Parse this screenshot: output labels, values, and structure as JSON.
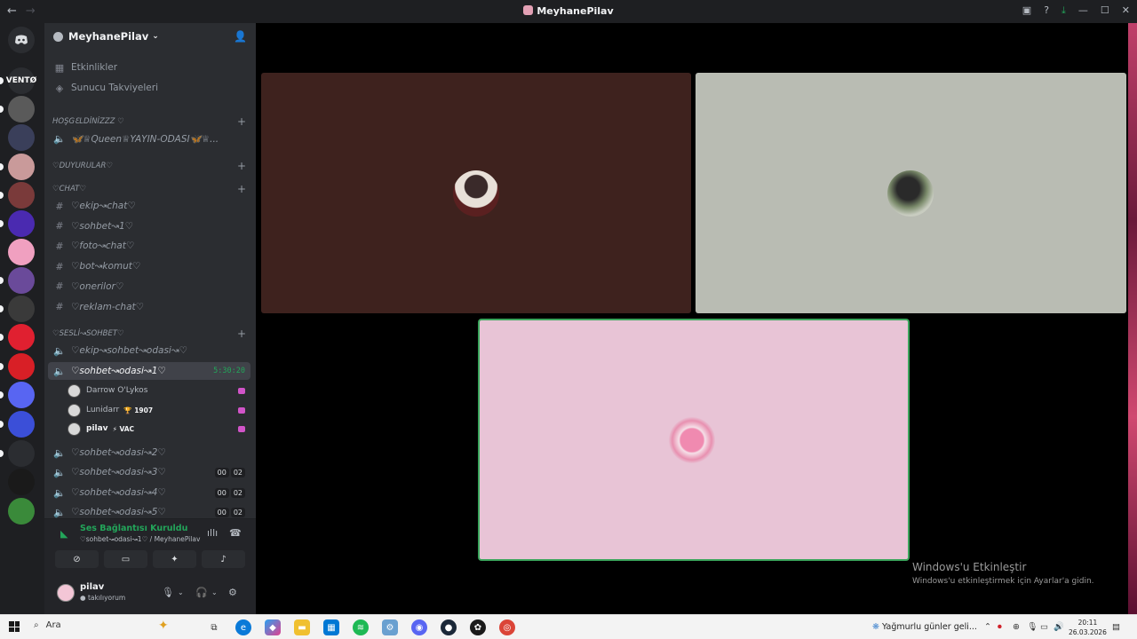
{
  "window": {
    "title": "MeyhanePilav",
    "nav_back": "←",
    "nav_forward": "→"
  },
  "server_rail": {
    "items": [
      {
        "label": "VENTØ",
        "color": "#2b2d31"
      },
      {
        "label": "",
        "color": "#5a5a5a"
      },
      {
        "label": "",
        "color": "#3a3f5a"
      },
      {
        "label": "",
        "color": "#c99a9a"
      },
      {
        "label": "",
        "color": "#7a3a3a"
      },
      {
        "label": "",
        "color": "#4a2ab0"
      },
      {
        "label": "",
        "color": "#f0a0c0"
      },
      {
        "label": "",
        "color": "#6a4a9a"
      },
      {
        "label": "",
        "color": "#3a3a3a"
      },
      {
        "label": "",
        "color": "#e02030"
      },
      {
        "label": "",
        "color": "#d81f26"
      },
      {
        "label": "",
        "color": "#5865f2"
      },
      {
        "label": "",
        "color": "#3b4fd8"
      },
      {
        "label": "",
        "color": "#2b2d31"
      },
      {
        "label": "",
        "color": "#1a1a1a"
      },
      {
        "label": "",
        "color": "#3a8a3a"
      }
    ]
  },
  "sidebar": {
    "server_name": "MeyhanePilav",
    "top_items": [
      {
        "label": "Etkinlikler",
        "icon": "calendar-icon"
      },
      {
        "label": "Sunucu Takviyeleri",
        "icon": "boost-icon"
      }
    ],
    "categories": [
      {
        "label": "HOŞGƐLDİNİZZZ ♡"
      },
      {
        "label": "♡DUYURULAR♡"
      },
      {
        "label": "♡CHAT♡"
      },
      {
        "label": "♡SESLİ↝SOHBET♡"
      }
    ],
    "voice_top": "🦋♕Queen♕YAYIN-ODASI🦋♕...",
    "text_channels": [
      "♡ekip↝chat♡",
      "♡sohbet↝1♡",
      "♡foto↝chat♡",
      "♡bot↝komut♡",
      "♡onerilor♡",
      "♡reklam-chat♡"
    ],
    "voice_channels": [
      {
        "label": "♡ekip↝sohbet↝odasi↝♡"
      },
      {
        "label": "♡sohbet↝odasi↝1♡",
        "timer": "5:30:20",
        "active": true
      },
      {
        "label": "♡sohbet↝odasi↝2♡"
      },
      {
        "label": "♡sohbet↝odasi↝3♡",
        "count_a": "00",
        "count_b": "02"
      },
      {
        "label": "♡sohbet↝odasi↝4♡",
        "count_a": "00",
        "count_b": "02"
      },
      {
        "label": "♡sohbet↝odasi↝5♡",
        "count_a": "00",
        "count_b": "02"
      }
    ],
    "voice_users": [
      {
        "name": "Darrow O'Lykos",
        "tag": ""
      },
      {
        "name": "Lunidarr",
        "tag": "🏆 1907"
      },
      {
        "name": "pilav",
        "tag": "⚡ VAC"
      }
    ]
  },
  "voice_panel": {
    "status": "Ses Bağlantısı Kuruldu",
    "channel": "♡sohbet↝odasi↝1♡ / MeyhanePilav"
  },
  "user_panel": {
    "username": "pilav",
    "status": "takılıyorum"
  },
  "stage": {
    "tiles": [
      {
        "bg": "#3e221e"
      },
      {
        "bg": "#b9bcb3"
      },
      {
        "bg": "#e8c4d6",
        "speaking": true
      }
    ]
  },
  "watermark": {
    "line1": "Windows'u Etkinleştir",
    "line2": "Windows'u etkinleştirmek için Ayarlar'a gidin."
  },
  "taskbar": {
    "search_label": "Ara",
    "weather": "Yağmurlu günler geli...",
    "time": "20:11",
    "date": "26.03.2026"
  }
}
